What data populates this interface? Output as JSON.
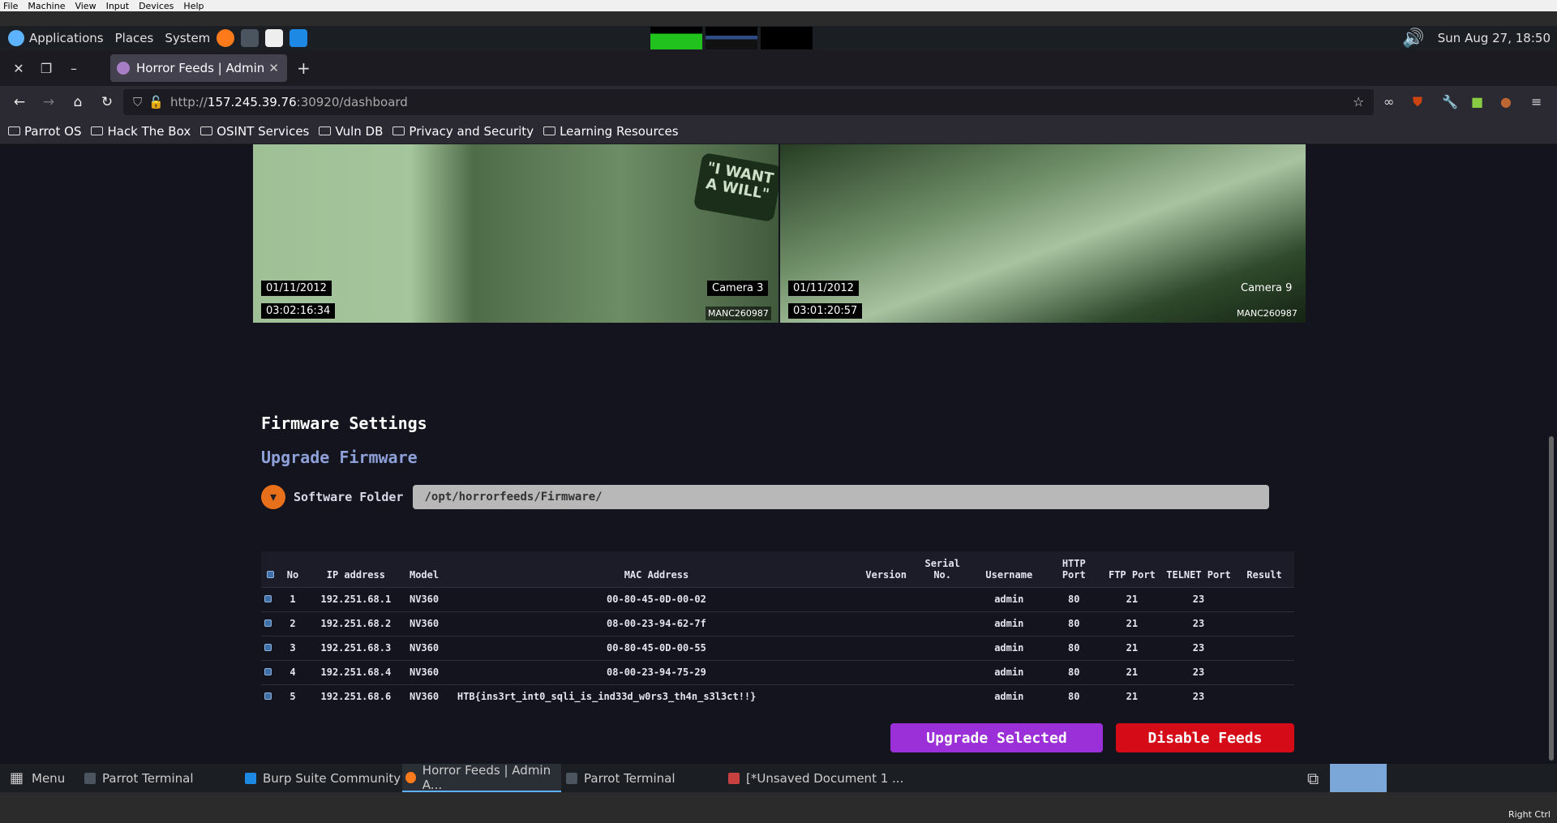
{
  "vbox_menu": [
    "File",
    "Machine",
    "View",
    "Input",
    "Devices",
    "Help"
  ],
  "panel": {
    "applications": "Applications",
    "places": "Places",
    "system": "System",
    "datetime": "Sun Aug 27, 18:50"
  },
  "browser": {
    "tab_title": "Horror Feeds | Admin Area",
    "url_prefix": "http://",
    "url_host": "157.245.39.76",
    "url_rest": ":30920/dashboard",
    "bookmarks": [
      "Parrot OS",
      "Hack The Box",
      "OSINT Services",
      "Vuln DB",
      "Privacy and Security",
      "Learning Resources"
    ]
  },
  "cameras": [
    {
      "date": "01/11/2012",
      "time": "03:02:16:34",
      "name": "Camera 3",
      "id": "MANC260987",
      "sign": "\"I WANT A WILL\""
    },
    {
      "date": "01/11/2012",
      "time": "03:01:20:57",
      "name": "Camera 9",
      "id": "MANC260987"
    }
  ],
  "firmware": {
    "title": "Firmware Settings",
    "subtitle": "Upgrade Firmware",
    "folder_label": "Software Folder",
    "folder_value": "/opt/horrorfeeds/Firmware/"
  },
  "table": {
    "headers": [
      "No",
      "IP address",
      "Model",
      "MAC Address",
      "Version",
      "Serial No.",
      "Username",
      "HTTP Port",
      "FTP Port",
      "TELNET Port",
      "Result"
    ],
    "rows": [
      {
        "no": "1",
        "ip": "192.251.68.1",
        "model": "NV360",
        "mac": "00-80-45-0D-00-02",
        "version": "",
        "serial": "",
        "user": "admin",
        "http": "80",
        "ftp": "21",
        "telnet": "23",
        "result": ""
      },
      {
        "no": "2",
        "ip": "192.251.68.2",
        "model": "NV360",
        "mac": "08-00-23-94-62-7f",
        "version": "",
        "serial": "",
        "user": "admin",
        "http": "80",
        "ftp": "21",
        "telnet": "23",
        "result": ""
      },
      {
        "no": "3",
        "ip": "192.251.68.3",
        "model": "NV360",
        "mac": "00-80-45-0D-00-55",
        "version": "",
        "serial": "",
        "user": "admin",
        "http": "80",
        "ftp": "21",
        "telnet": "23",
        "result": ""
      },
      {
        "no": "4",
        "ip": "192.251.68.4",
        "model": "NV360",
        "mac": "08-00-23-94-75-29",
        "version": "",
        "serial": "",
        "user": "admin",
        "http": "80",
        "ftp": "21",
        "telnet": "23",
        "result": ""
      },
      {
        "no": "5",
        "ip": "192.251.68.6",
        "model": "NV360",
        "mac": "HTB{ins3rt_int0_sqli_is_ind33d_w0rs3_th4n_s3l3ct!!}",
        "version": "",
        "serial": "",
        "user": "admin",
        "http": "80",
        "ftp": "21",
        "telnet": "23",
        "result": ""
      }
    ]
  },
  "buttons": {
    "upgrade": "Upgrade Selected",
    "disable": "Disable Feeds"
  },
  "taskbar": {
    "menu": "Menu",
    "items": [
      "Parrot Terminal",
      "Burp Suite Community ...",
      "Horror Feeds | Admin A...",
      "Parrot Terminal",
      "[*Unsaved Document 1 ..."
    ]
  },
  "vbox_status": {
    "host_key": "Right Ctrl"
  },
  "colors": {
    "page_bg": "#13141e",
    "upgrade_btn": "#9b30d9",
    "disable_btn": "#d50c18",
    "subtitle": "#8ea0d8"
  }
}
